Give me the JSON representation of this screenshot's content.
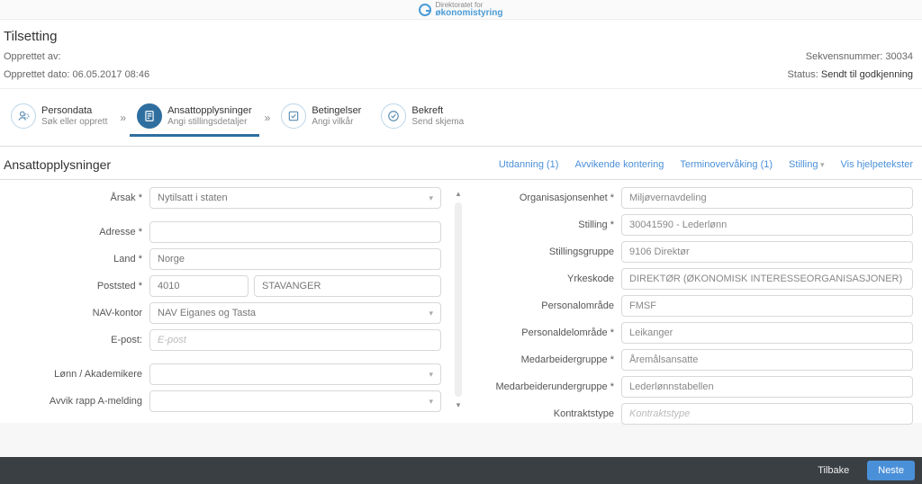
{
  "brand": {
    "line1": "Direktoratet for",
    "line2": "økonomistyring"
  },
  "header": {
    "title": "Tilsetting",
    "createdBy_label": "Opprettet av:",
    "createdBy_value": "",
    "createdDate_label": "Opprettet dato:",
    "createdDate_value": "06.05.2017 08:46",
    "sequence_label": "Sekvensnummer:",
    "sequence_value": "30034",
    "status_label": "Status:",
    "status_value": "Sendt til godkjenning"
  },
  "wizard": {
    "steps": [
      {
        "label": "Persondata",
        "sub": "Søk eller opprett"
      },
      {
        "label": "Ansattopplysninger",
        "sub": "Angi stillingsdetaljer"
      },
      {
        "label": "Betingelser",
        "sub": "Angi vilkår"
      },
      {
        "label": "Bekreft",
        "sub": "Send skjema"
      }
    ],
    "active_index": 1
  },
  "section": {
    "title": "Ansattopplysninger",
    "links": {
      "utdanning": "Utdanning (1)",
      "avvikende": "Avvikende kontering",
      "termin": "Terminovervåking (1)",
      "stilling": "Stilling",
      "hjelp": "Vis hjelpetekster"
    }
  },
  "left": {
    "aarsak_label": "Årsak",
    "aarsak_value": "Nytilsatt i staten",
    "adresse_label": "Adresse",
    "adresse_value": "",
    "land_label": "Land",
    "land_value": "Norge",
    "poststed_label": "Poststed",
    "postnr_value": "4010",
    "poststed_value": "STAVANGER",
    "nav_label": "NAV-kontor",
    "nav_value": "NAV Eiganes og Tasta",
    "epost_label": "E-post:",
    "epost_placeholder": "E-post",
    "lonn_label": "Lønn / Akademikere",
    "lonn_value": "",
    "avvik_label": "Avvik rapp A-melding",
    "avvik_value": ""
  },
  "right": {
    "orgenhet_label": "Organisasjonsenhet",
    "orgenhet_value": "Miljøvernavdeling",
    "stilling_label": "Stilling",
    "stilling_value": "30041590 - Lederlønn",
    "stillingsgruppe_label": "Stillingsgruppe",
    "stillingsgruppe_value": "9106 Direktør",
    "yrkeskode_label": "Yrkeskode",
    "yrkeskode_value": "DIREKTØR (ØKONOMISK INTERESSEORGANISASJONER)",
    "personalomrade_label": "Personalområde",
    "personalomrade_value": "FMSF",
    "personaldelomrade_label": "Personaldelområde",
    "personaldelomrade_value": "Leikanger",
    "medarbeidergruppe_label": "Medarbeidergruppe",
    "medarbeidergruppe_value": "Åremålsansatte",
    "medarbeiderundergruppe_label": "Medarbeiderundergruppe",
    "medarbeiderundergruppe_value": "Lederlønnstabellen",
    "kontraktstype_label": "Kontraktstype",
    "kontraktstype_placeholder": "Kontraktstype"
  },
  "footer": {
    "back": "Tilbake",
    "next": "Neste"
  }
}
